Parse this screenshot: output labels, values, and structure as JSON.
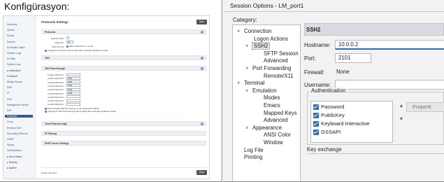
{
  "left": {
    "caption": "Konfigürasyon:",
    "nav": [
      {
        "label": "Summary"
      },
      {
        "label": "Alarms"
      },
      {
        "label": "Events"
      },
      {
        "label": "Reports"
      },
      {
        "label": "Scheduled Tasks"
      },
      {
        "label": "Session Logs"
      },
      {
        "label": "NI Stats"
      },
      {
        "label": "System Logs"
      },
      {
        "label": "▸ Automation",
        "group": true
      },
      {
        "label": "▾ Network",
        "group": true
      },
      {
        "label": "Bridge Groups"
      },
      {
        "label": "DNS"
      },
      {
        "label": "IP"
      },
      {
        "label": "IPv6"
      },
      {
        "label": "Management Server"
      },
      {
        "label": "NTP"
      },
      {
        "label": "Protocols",
        "active": true
      },
      {
        "label": "Proxy"
      },
      {
        "label": "Reverse SSH"
      },
      {
        "label": "Secondary Ethernet"
      },
      {
        "label": "SNMP"
      },
      {
        "label": "Syslog"
      },
      {
        "label": "Subinterfaces"
      },
      {
        "label": "▸ Out-of-Band",
        "group": true
      },
      {
        "label": "▸ Security",
        "group": true
      },
      {
        "label": "▸ System",
        "group": true
      }
    ],
    "title": "Protocols Settings",
    "save": "Save",
    "sections": {
      "protocols": "Protocols",
      "ssh": "SSH",
      "ssh_pass": "SSH Pass-through",
      "telnet_pass": "Telnet Pass-through",
      "ip_filtering": "IP Filtering",
      "dhcp": "DHCP Server Settings"
    },
    "protocols_rows": {
      "enable_telnet": "Enable Telnet",
      "ssh_port_label": "SSH Port",
      "ssh_port_value": "22",
      "scp_label": "SCP Port 22",
      "scp_option": "When \"SSH Port\" is not 22",
      "note": "Changes to Protocols will not take place until after appliance restart."
    },
    "ssh_pass_rows": [
      {
        "label": "modem SSH Port",
        "value": ""
      },
      {
        "label": "port1/1 SSH Port",
        "value": "2101"
      },
      {
        "label": "port1/2 SSH Port",
        "value": "2102"
      },
      {
        "label": "port1/3 SSH Port",
        "value": "2103"
      },
      {
        "label": "port1/4 SSH Port",
        "value": "2104"
      },
      {
        "label": "port1/5 SSH Port",
        "value": "2105"
      },
      {
        "label": "port1/6 SSH Port",
        "value": ""
      },
      {
        "label": "port1/7 SSH Port",
        "value": ""
      },
      {
        "label": "port1/8 SSH Port",
        "value": ""
      }
    ],
    "ssh_pass_notes": [
      "Pass-through SSH Port must be in the range 1024-10000.",
      "Changes to SSH Pass-through will not take place until after appliance restart."
    ],
    "footer": "Scope: inherited"
  },
  "right": {
    "window_title": "Session Options - LM_port1",
    "category_label": "Category:",
    "tree": [
      {
        "label": "Connection",
        "level": 0,
        "chevron": "down"
      },
      {
        "label": "Logon Actions",
        "level": 1
      },
      {
        "label": "SSH2",
        "level": 0,
        "chevron": "down",
        "selected": true,
        "indent": 1
      },
      {
        "label": "SFTP Session",
        "level": 2
      },
      {
        "label": "Advanced",
        "level": 2
      },
      {
        "label": "Port Forwarding",
        "level": 0,
        "chevron": "down",
        "indent": 1
      },
      {
        "label": "Remote/X11",
        "level": 2
      },
      {
        "label": "Terminal",
        "level": 0,
        "chevron": "down"
      },
      {
        "label": "Emulation",
        "level": 0,
        "chevron": "down",
        "indent": 1
      },
      {
        "label": "Modes",
        "level": 2
      },
      {
        "label": "Emacs",
        "level": 2
      },
      {
        "label": "Mapped Keys",
        "level": 2
      },
      {
        "label": "Advanced",
        "level": 2
      },
      {
        "label": "Appearance",
        "level": 0,
        "chevron": "down",
        "indent": 1
      },
      {
        "label": "ANSI Color",
        "level": 2
      },
      {
        "label": "Window",
        "level": 2
      },
      {
        "label": "Log File",
        "level": 1
      },
      {
        "label": "Printing",
        "level": 1
      }
    ],
    "section_header": "SSH2",
    "hostname_label": "Hostname:",
    "hostname_value": "10.0.0.2",
    "port_label": "Port:",
    "port_value": "2101",
    "firewall_label": "Firewall:",
    "firewall_value": "None",
    "username_label": "Username:",
    "username_value": "",
    "auth_title": "Authentication",
    "auth_methods": [
      "Password",
      "PublicKey",
      "Keyboard Interactive",
      "GSSAPI"
    ],
    "properties_button": "Properti",
    "kex_label": "Key exchange",
    "accent": "#2a6cb8"
  }
}
